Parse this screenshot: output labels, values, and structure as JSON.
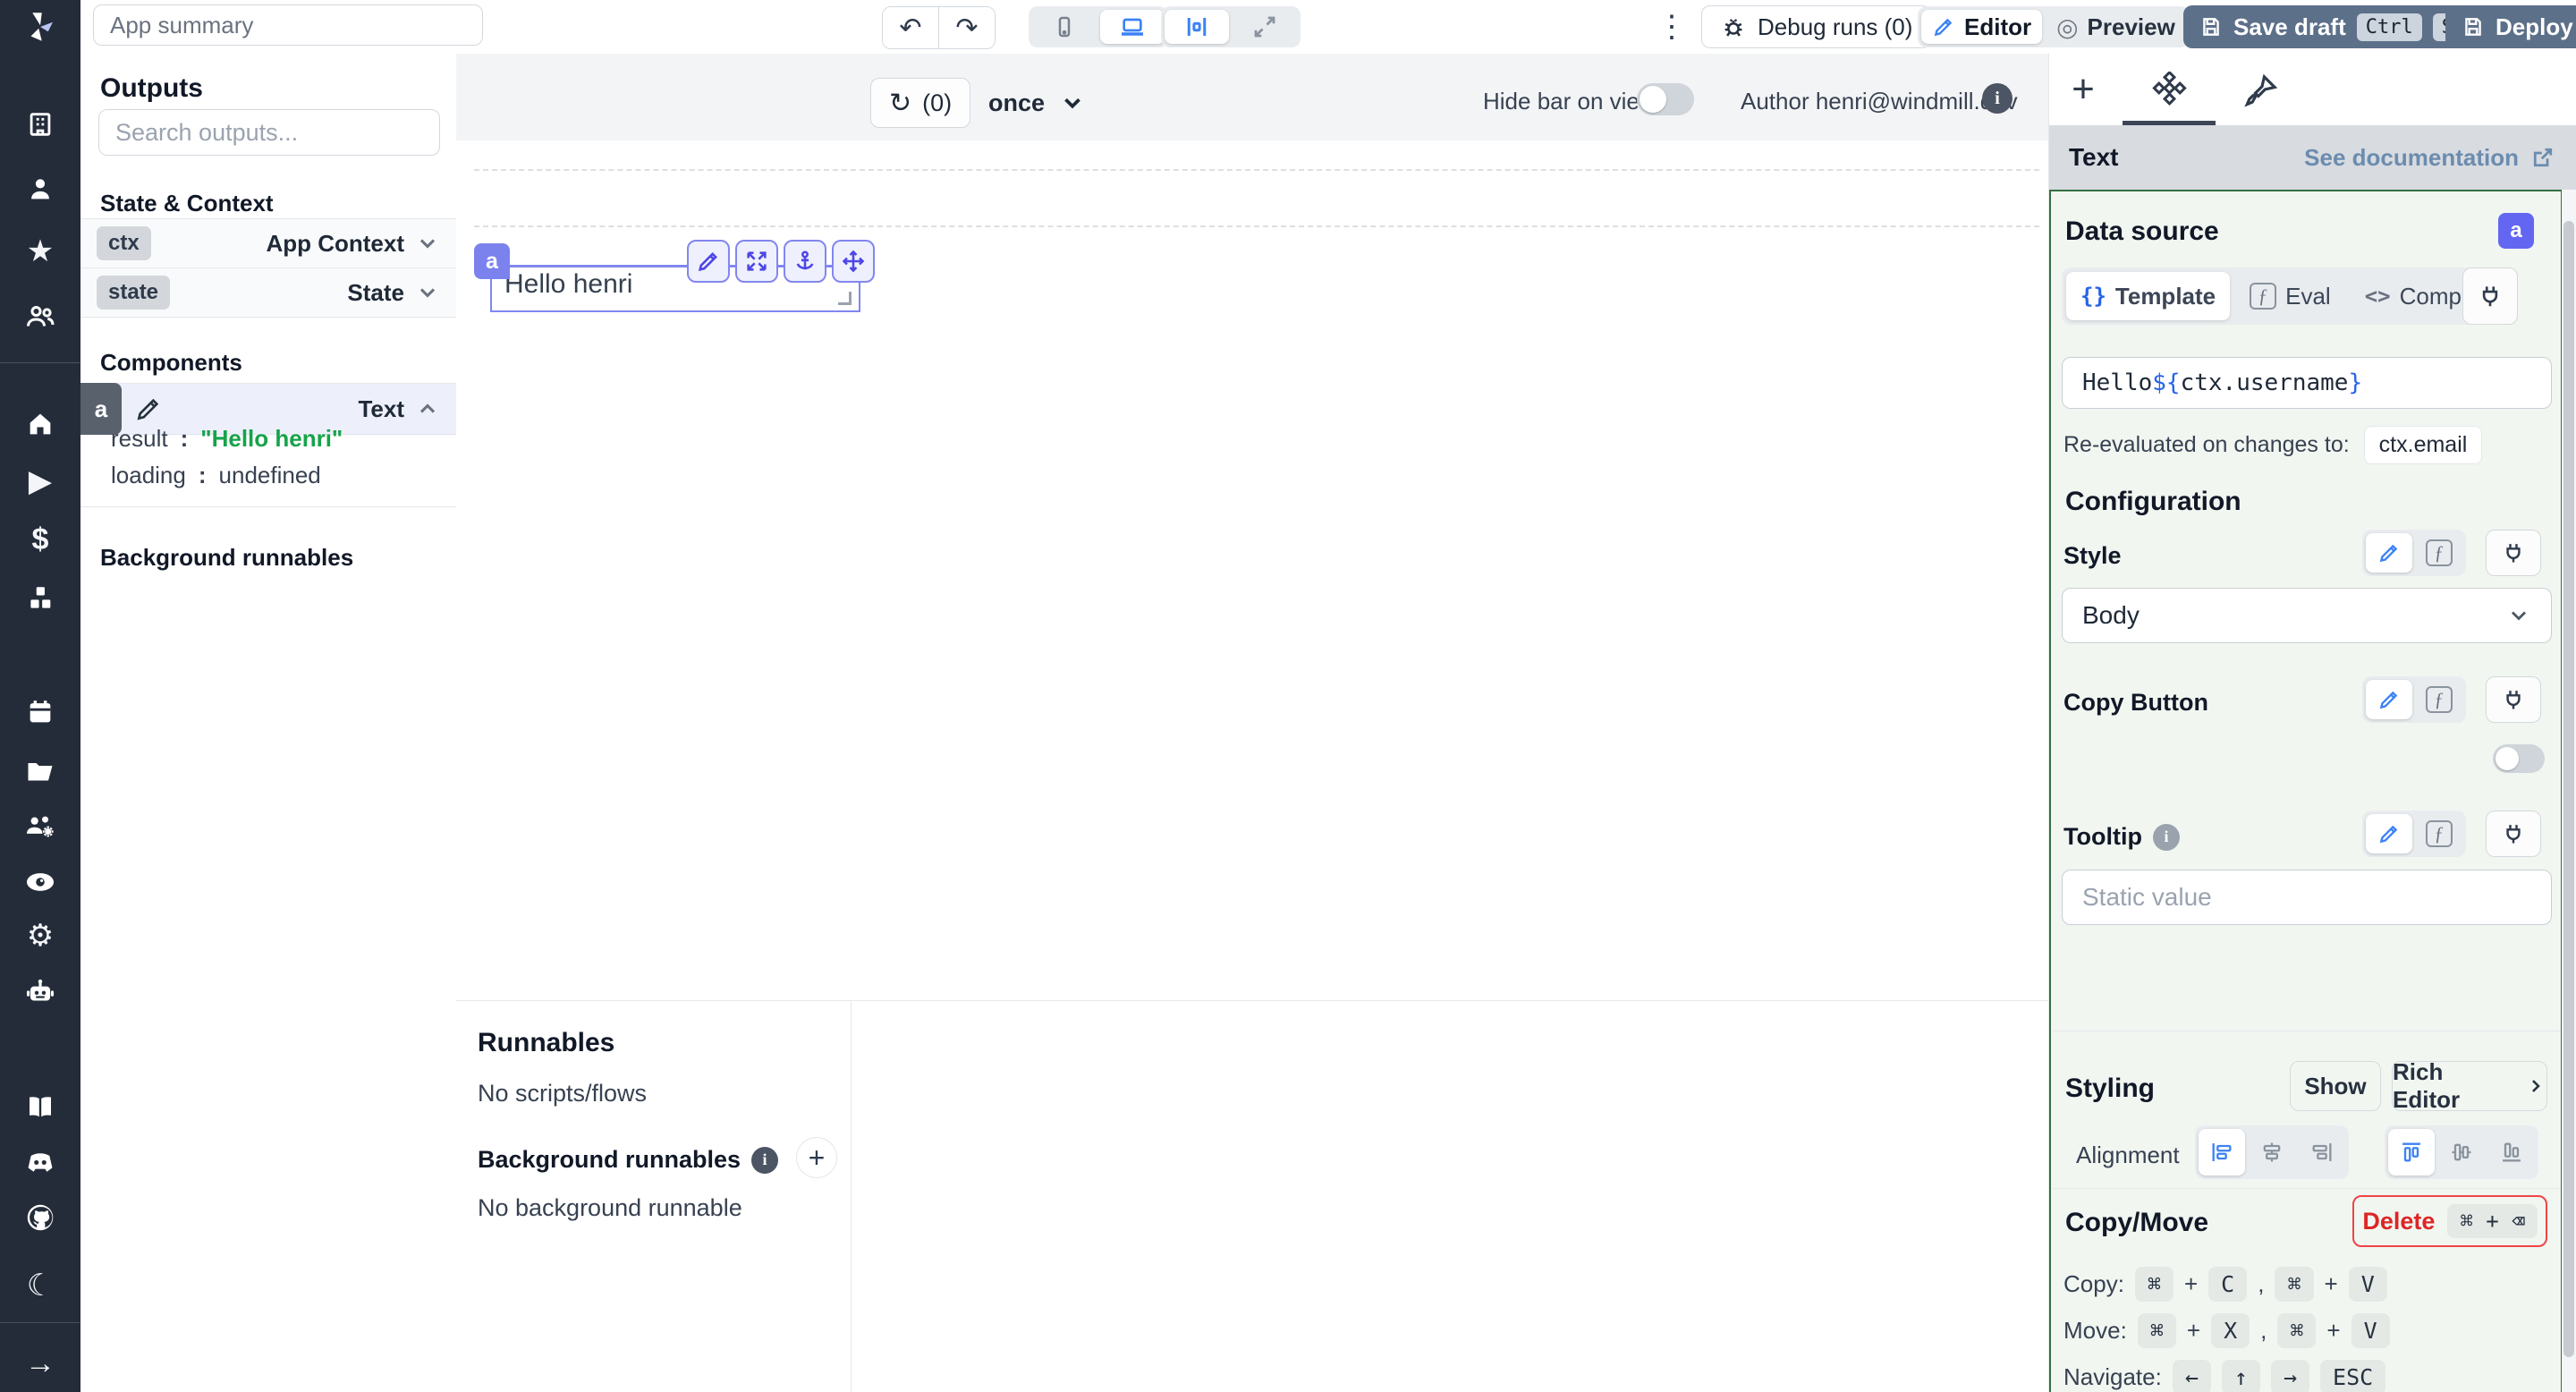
{
  "glyphs": {
    "undo": "↶",
    "redo": "↷",
    "refresh": "↻",
    "kebab": "⋮",
    "preview": "◎",
    "braces": "{}",
    "fn": "ƒ",
    "angles": "<>",
    "plus": "+",
    "comma": ",",
    "colon": ":",
    "info": "i",
    "star": "★",
    "play": "▶",
    "dollar": "$",
    "gear": "⚙",
    "moon": "☾",
    "arrow": "→"
  },
  "topbar": {
    "app_summary_placeholder": "App summary",
    "debug_runs": "Debug runs (0)",
    "editor": "Editor",
    "preview": "Preview",
    "save_draft": "Save draft",
    "save_keys": [
      "Ctrl",
      "S"
    ],
    "deploy": "Deploy"
  },
  "outputs": {
    "title": "Outputs",
    "search_placeholder": "Search outputs...",
    "state_context_title": "State & Context",
    "rows": [
      {
        "badge": "ctx",
        "label": "App Context"
      },
      {
        "badge": "state",
        "label": "State"
      }
    ],
    "components_title": "Components",
    "component": {
      "badge": "a",
      "type": "Text"
    },
    "props": [
      {
        "key": "result",
        "value": "\"Hello henri\""
      },
      {
        "key": "loading",
        "value": "undefined"
      }
    ],
    "background_title": "Background runnables"
  },
  "canvas": {
    "refresh_count": "(0)",
    "schedule": "once",
    "hide_bar": "Hide bar on view",
    "author": "Author henri@windmill.dev",
    "component_id": "a",
    "component_text": "Hello henri"
  },
  "runnables": {
    "title": "Runnables",
    "empty": "No scripts/flows",
    "background_title": "Background runnables",
    "background_empty": "No background runnable"
  },
  "right": {
    "component_type": "Text",
    "see_documentation": "See documentation",
    "data_source": {
      "title": "Data source",
      "badge": "a",
      "tab_template": "Template",
      "tab_eval": "Eval",
      "tab_compute": "Compute",
      "code": {
        "prefix": "Hello ",
        "open": "${",
        "expr": "ctx.username",
        "close": "}"
      },
      "reeval_label": "Re-evaluated on changes to:",
      "reeval_dep": "ctx.email"
    },
    "configuration": {
      "title": "Configuration",
      "style_label": "Style",
      "style_value": "Body",
      "copy_button_label": "Copy Button",
      "tooltip_label": "Tooltip",
      "tooltip_placeholder": "Static value"
    },
    "styling": {
      "title": "Styling",
      "show": "Show",
      "rich_editor": "Rich Editor",
      "alignment_label": "Alignment"
    },
    "copymove": {
      "title": "Copy/Move",
      "delete": "Delete",
      "delete_keys": "⌘ + ⌫",
      "rows": [
        {
          "label": "Copy:",
          "keys": [
            "⌘",
            "C",
            "⌘",
            "V"
          ]
        },
        {
          "label": "Move:",
          "keys": [
            "⌘",
            "X",
            "⌘",
            "V"
          ]
        }
      ],
      "navigate_label": "Navigate:",
      "navigate_keys": [
        "←",
        "↑",
        "→",
        "ESC"
      ]
    }
  }
}
